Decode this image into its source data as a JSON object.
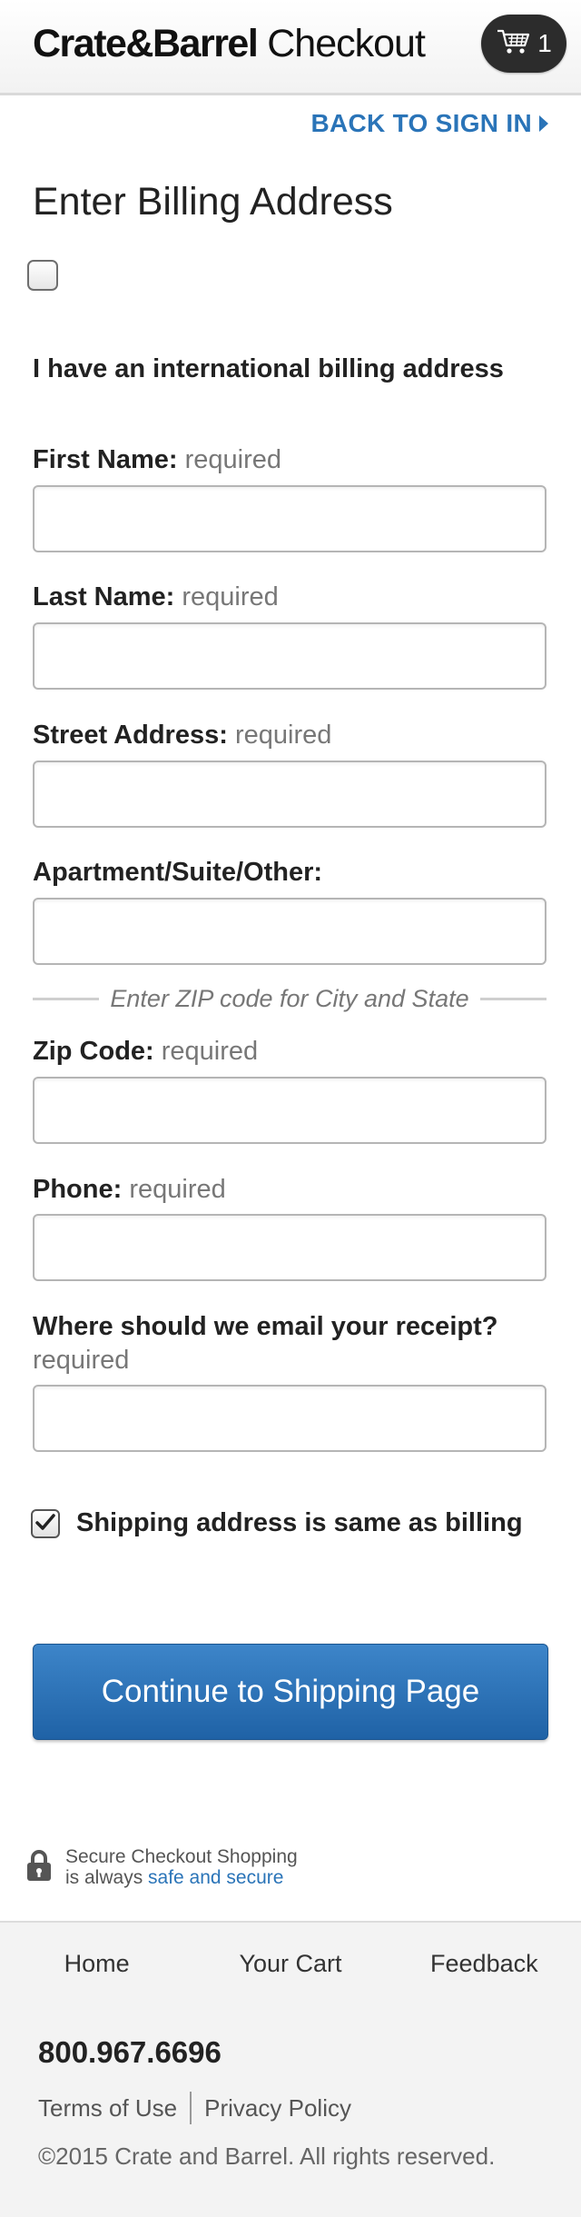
{
  "header": {
    "brand_bold": "Crate&Barrel",
    "brand_light": " Checkout",
    "cart_count": "1"
  },
  "back_link": "BACK TO SIGN IN",
  "page_title": "Enter Billing Address",
  "intl_label": "I have an international billing address",
  "required_text": "required",
  "fields": {
    "first_name": "First Name:",
    "last_name": "Last Name:",
    "street": "Street Address:",
    "apartment": "Apartment/Suite/Other:",
    "zip": "Zip Code:",
    "phone": "Phone:",
    "email": "Where should we email your receipt?"
  },
  "zip_hint": "Enter ZIP code for City and State",
  "shipping_same_label": "Shipping address is same as billing",
  "shipping_same_checked": true,
  "continue_button": "Continue to Shipping Page",
  "secure": {
    "line1": "Secure Checkout Shopping",
    "line2_prefix": "is always ",
    "line2_link": "safe and secure"
  },
  "footer_nav": [
    "Home",
    "Your Cart",
    "Feedback"
  ],
  "footer": {
    "phone": "800.967.6696",
    "terms": "Terms of Use",
    "privacy": "Privacy Policy",
    "copyright": "©2015 Crate and Barrel. All rights reserved."
  },
  "colors": {
    "link_blue": "#2a74b8",
    "button_blue": "#1f62a6",
    "cart_dark": "#2c2c2c"
  },
  "icons": [
    "shopping-cart-icon",
    "caret-right-icon",
    "checkmark-icon",
    "lock-icon"
  ]
}
